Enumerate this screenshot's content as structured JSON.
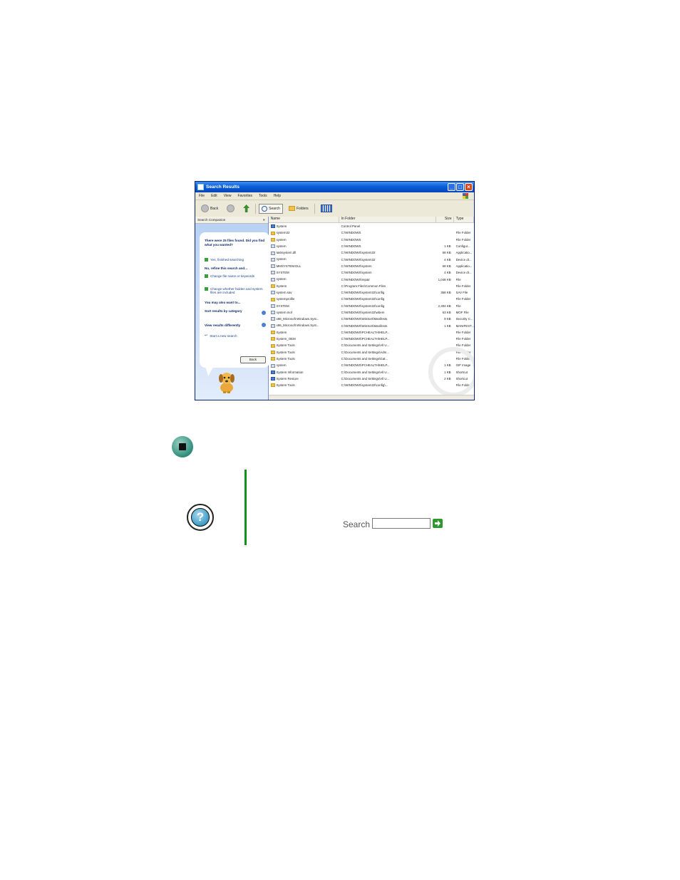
{
  "window": {
    "title": "Search Results",
    "menu": [
      "File",
      "Edit",
      "View",
      "Favorites",
      "Tools",
      "Help"
    ],
    "toolbar": {
      "back": "Back",
      "search": "Search",
      "folders": "Folders"
    }
  },
  "companion": {
    "header": "Search Companion",
    "found": "There were 25 files found. Did you find what you wanted?",
    "yes_option": "Yes, finished searching",
    "refine_heading": "No, refine this search and...",
    "change_name": "Change file name or keywords",
    "change_hidden": "Change whether hidden and system files are included",
    "also_heading": "You may also want to...",
    "sort_by_category": "Sort results by category",
    "view_differently": "View results differently",
    "new_search": "Start a new search",
    "back_button": "Back"
  },
  "list": {
    "columns": {
      "name": "Name",
      "folder": "In Folder",
      "size": "Size",
      "type": "Type"
    },
    "rows": [
      {
        "icon": "app",
        "name": "System",
        "folder": "Control Panel",
        "size": "",
        "type": ""
      },
      {
        "icon": "folder",
        "name": "system32",
        "folder": "C:\\WINDOWS",
        "size": "",
        "type": "File Folder"
      },
      {
        "icon": "folder",
        "name": "system",
        "folder": "C:\\WINDOWS",
        "size": "",
        "type": "File Folder"
      },
      {
        "icon": "file",
        "name": "system",
        "folder": "C:\\WINDOWS",
        "size": "1 KB",
        "type": "Configur..."
      },
      {
        "icon": "file",
        "name": "tasksystem.dll",
        "folder": "C:\\WINDOWS\\system32",
        "size": "68 KB",
        "type": "Applicatio..."
      },
      {
        "icon": "file",
        "name": "system",
        "folder": "C:\\WINDOWS\\system32",
        "size": "4 KB",
        "type": "Device dr..."
      },
      {
        "icon": "file",
        "name": "MMSYSTEM.DLL",
        "folder": "C:\\WINDOWS\\system",
        "size": "68 KB",
        "type": "Applicatio..."
      },
      {
        "icon": "file",
        "name": "SYSTEM",
        "folder": "C:\\WINDOWS\\system",
        "size": "4 KB",
        "type": "Device dr..."
      },
      {
        "icon": "file",
        "name": "system",
        "folder": "C:\\WINDOWS\\repair",
        "size": "1,048 KB",
        "type": "File"
      },
      {
        "icon": "folder",
        "name": "System",
        "folder": "C:\\Program Files\\Common Files",
        "size": "",
        "type": "File Folder"
      },
      {
        "icon": "file",
        "name": "system.sav",
        "folder": "C:\\WINDOWS\\system32\\config",
        "size": "368 KB",
        "type": "SAV File"
      },
      {
        "icon": "folder",
        "name": "systemprofile",
        "folder": "C:\\WINDOWS\\system32\\config",
        "size": "",
        "type": "File Folder"
      },
      {
        "icon": "file",
        "name": "SYSTEM",
        "folder": "C:\\WINDOWS\\system32\\config",
        "size": "2,304 KB",
        "type": "File"
      },
      {
        "icon": "file",
        "name": "system.mof",
        "folder": "C:\\WINDOWS\\system32\\wbem",
        "size": "63 KB",
        "type": "MOF File"
      },
      {
        "icon": "file",
        "name": "x86_Microsoft.Windows.Syst...",
        "folder": "C:\\WINDOWS\\WinSxS\\Manifests",
        "size": "9 KB",
        "type": "Security C..."
      },
      {
        "icon": "file",
        "name": "x86_Microsoft.Windows.Syst...",
        "folder": "C:\\WINDOWS\\WinSxS\\Manifests",
        "size": "1 KB",
        "type": "MANIFEST..."
      },
      {
        "icon": "folder",
        "name": "System",
        "folder": "C:\\WINDOWS\\PCHEALTH\\HELP...",
        "size": "",
        "type": "File Folder"
      },
      {
        "icon": "folder",
        "name": "System_OEM",
        "folder": "C:\\WINDOWS\\PCHEALTH\\HELP...",
        "size": "",
        "type": "File Folder"
      },
      {
        "icon": "folder",
        "name": "System Tools",
        "folder": "C:\\Documents and Settings\\All U...",
        "size": "",
        "type": "File Folder"
      },
      {
        "icon": "folder",
        "name": "System Tools",
        "folder": "C:\\Documents and Settings\\Adm...",
        "size": "",
        "type": "File Folder"
      },
      {
        "icon": "folder",
        "name": "System Tools",
        "folder": "C:\\Documents and Settings\\Gat...",
        "size": "",
        "type": "File Folder"
      },
      {
        "icon": "file",
        "name": "system",
        "folder": "C:\\WINDOWS\\PCHEALTH\\HELP...",
        "size": "1 KB",
        "type": "GIF Image"
      },
      {
        "icon": "app",
        "name": "System Information",
        "folder": "C:\\Documents and Settings\\All U...",
        "size": "1 KB",
        "type": "Shortcut"
      },
      {
        "icon": "app",
        "name": "System Restore",
        "folder": "C:\\Documents and Settings\\All U...",
        "size": "2 KB",
        "type": "Shortcut"
      },
      {
        "icon": "folder",
        "name": "System Tools",
        "folder": "C:\\WINDOWS\\system32\\config\\...",
        "size": "",
        "type": "File Folder"
      }
    ]
  },
  "help_search": {
    "label": "Search"
  }
}
